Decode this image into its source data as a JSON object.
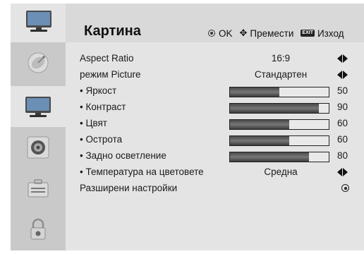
{
  "header": {
    "title": "Картина",
    "ok_label": "OK",
    "move_label": "Премести",
    "exit_badge": "EXIT",
    "exit_label": "Изход",
    "icon": "tv-icon"
  },
  "sidebar": {
    "items": [
      {
        "name": "satellite-dish-icon",
        "active": false
      },
      {
        "name": "tv-picture-icon",
        "active": true
      },
      {
        "name": "speaker-icon",
        "active": false
      },
      {
        "name": "toolbox-icon",
        "active": false
      },
      {
        "name": "lock-icon",
        "active": false
      }
    ]
  },
  "menu": {
    "rows": [
      {
        "label": "Aspect Ratio",
        "type": "select",
        "value": "16:9"
      },
      {
        "label": "режим Picture",
        "type": "select",
        "value": "Стандартен"
      },
      {
        "label": "• Яркост",
        "type": "slider",
        "value": "50",
        "level": 50,
        "max": 100
      },
      {
        "label": "• Контраст",
        "type": "slider",
        "value": "90",
        "level": 90,
        "max": 100
      },
      {
        "label": "• Цвят",
        "type": "slider",
        "value": "60",
        "level": 60,
        "max": 100
      },
      {
        "label": "• Острота",
        "type": "slider",
        "value": "60",
        "level": 60,
        "max": 100
      },
      {
        "label": "• Задно осветление",
        "type": "slider",
        "value": "80",
        "level": 80,
        "max": 100
      },
      {
        "label": "• Температура на цветовете",
        "type": "select",
        "value": "Средна"
      },
      {
        "label": "Разширени настройки",
        "type": "submenu",
        "value": ""
      }
    ]
  },
  "colors": {
    "header_bg": "#d9d9d9",
    "panel_bg": "#e4e4e4",
    "sidebar_bg": "#c9c9c9",
    "bar_fill": "#555555"
  }
}
